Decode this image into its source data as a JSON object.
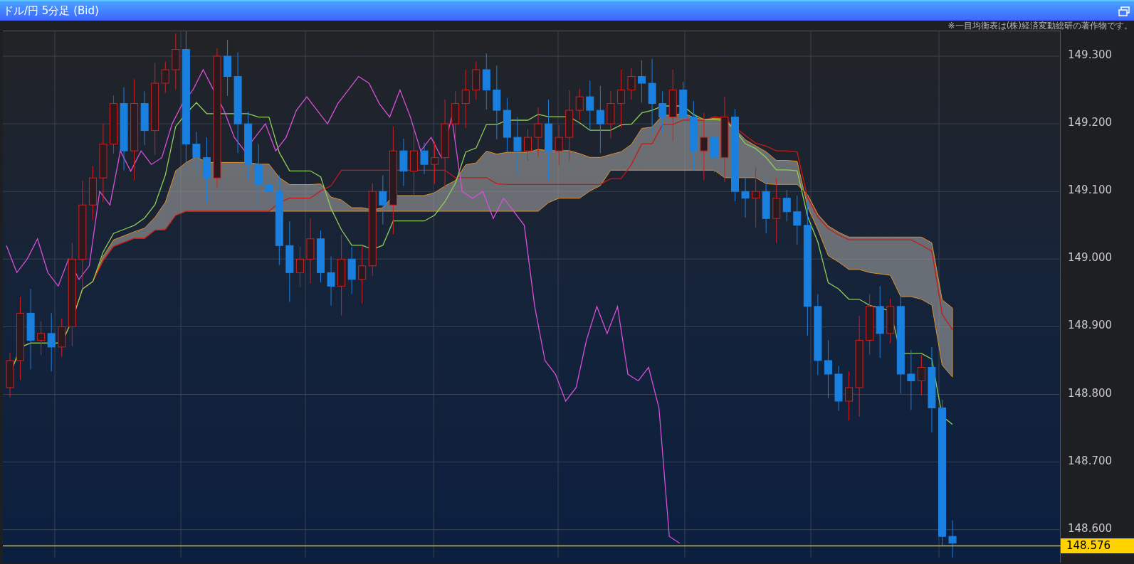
{
  "window": {
    "title": "ドル/円 5分足 (Bid)"
  },
  "notice": "※一目均衡表は(株)経済変動総研の著作物です。",
  "price_axis": {
    "ticks": [
      "149.300",
      "149.200",
      "149.100",
      "149.000",
      "148.900",
      "148.800",
      "148.700",
      "148.600"
    ],
    "current_price": "148.576"
  }
}
